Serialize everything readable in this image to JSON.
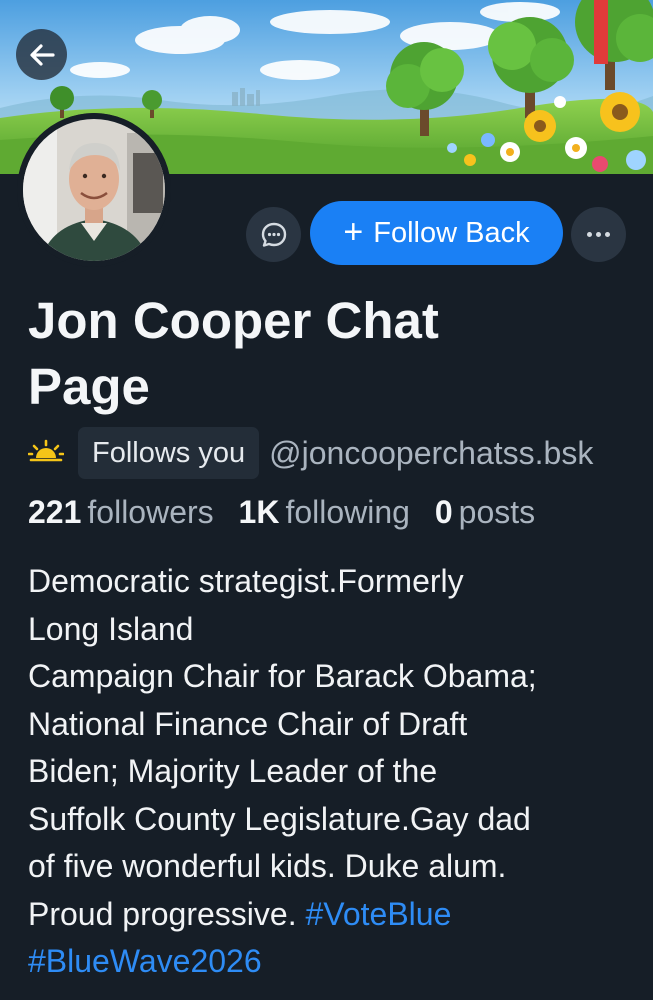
{
  "header": {
    "back_icon": "arrow-left-icon"
  },
  "profile": {
    "display_name_line1": "Jon Cooper Chat",
    "display_name_line2": "Page",
    "pronoun_icon": "sun-icon",
    "follows_you_label": "Follows you",
    "handle": "@joncooperchatss.bsk"
  },
  "actions": {
    "message_icon": "chat-bubble-icon",
    "follow_back_label": "Follow Back",
    "follow_back_icon": "plus-icon",
    "more_icon": "ellipsis-icon"
  },
  "stats": {
    "followers_count": "221",
    "followers_label": "followers",
    "following_count": "1K",
    "following_label": "following",
    "posts_count": "0",
    "posts_label": "posts"
  },
  "bio": {
    "lines": [
      "Democratic strategist.Formerly",
      "Long Island",
      "Campaign Chair for Barack Obama;",
      "National Finance Chair of Draft",
      "Biden; Majority Leader of the",
      "Suffolk County Legislature.Gay dad",
      "of five wonderful kids. Duke alum.",
      "Proud progressive. "
    ],
    "hashtag_1": "#VoteBlue",
    "hashtag_2": "#BlueWave2026"
  },
  "colors": {
    "background": "#161e27",
    "accent_blue": "#1a80f5",
    "hashtag_blue": "#2e8cf5",
    "muted_text": "#aab4bf"
  }
}
